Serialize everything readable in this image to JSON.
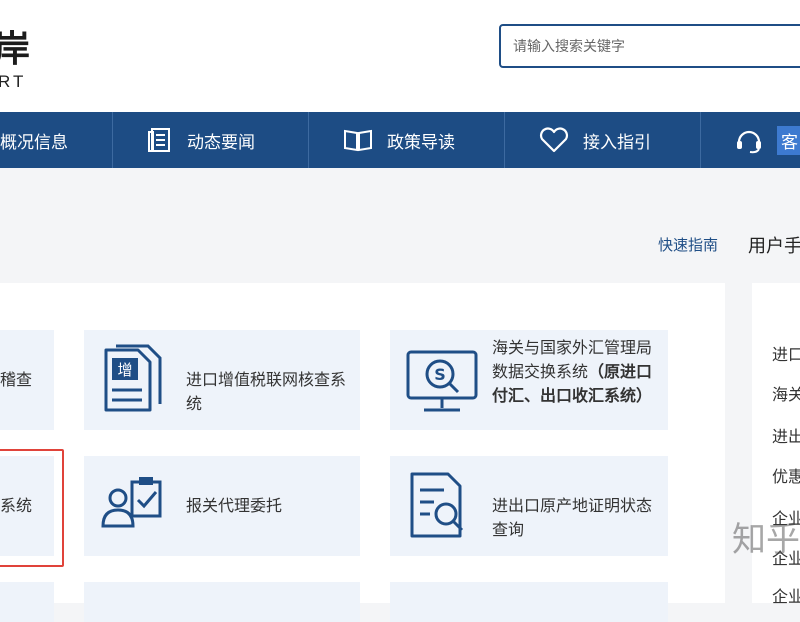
{
  "header": {
    "brand_title": "岸",
    "brand_subtitle": "RT",
    "search_placeholder": "请输入搜索关键字"
  },
  "nav": {
    "items": [
      {
        "label": "概况信息",
        "icon": "list-icon"
      },
      {
        "label": "动态要闻",
        "icon": "document-icon"
      },
      {
        "label": "政策导读",
        "icon": "book-icon"
      },
      {
        "label": "接入指引",
        "icon": "heart-icon"
      },
      {
        "label": "客",
        "icon": "headset-icon"
      }
    ]
  },
  "links": {
    "quick_guide": "快速指南",
    "user_guide": "用户手"
  },
  "cards": [
    {
      "text": "稽查",
      "icon": ""
    },
    {
      "text": "进口增值税联网核查系统",
      "icon": "vat-document-icon",
      "icon_label": "增"
    },
    {
      "text_line1": "海关与国家外汇管理",
      "text_line2": "局数据交换系统",
      "text_bold": "（原进口付汇、出口收汇系统）",
      "icon": "monitor-currency-icon"
    },
    {
      "text": "系统",
      "icon": ""
    },
    {
      "text": "报关代理委托",
      "icon": "agent-clipboard-icon"
    },
    {
      "text": "进出口原产地证明状态查询",
      "icon": "document-search-icon"
    }
  ],
  "sidebar": {
    "items": [
      "进口",
      "海关",
      "进出",
      "优惠",
      "企业",
      "企业",
      "企业"
    ]
  },
  "watermark": "知乎"
}
